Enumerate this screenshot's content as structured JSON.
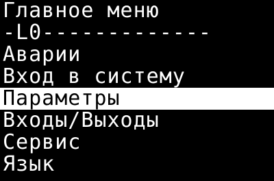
{
  "screen": {
    "title": "Главное меню",
    "level_line": "-L0-------------",
    "menu_items": [
      {
        "label": "Аварии",
        "selected": false
      },
      {
        "label": "Вход в систему",
        "selected": false
      },
      {
        "label": "Параметры",
        "selected": true
      },
      {
        "label": "Входы/Выходы",
        "selected": false
      },
      {
        "label": "Сервис",
        "selected": false
      },
      {
        "label": "Язык",
        "selected": false
      }
    ],
    "colors": {
      "background": "#000000",
      "text": "#ffffff",
      "selection_background": "#ffffff",
      "selection_text": "#000000"
    }
  }
}
